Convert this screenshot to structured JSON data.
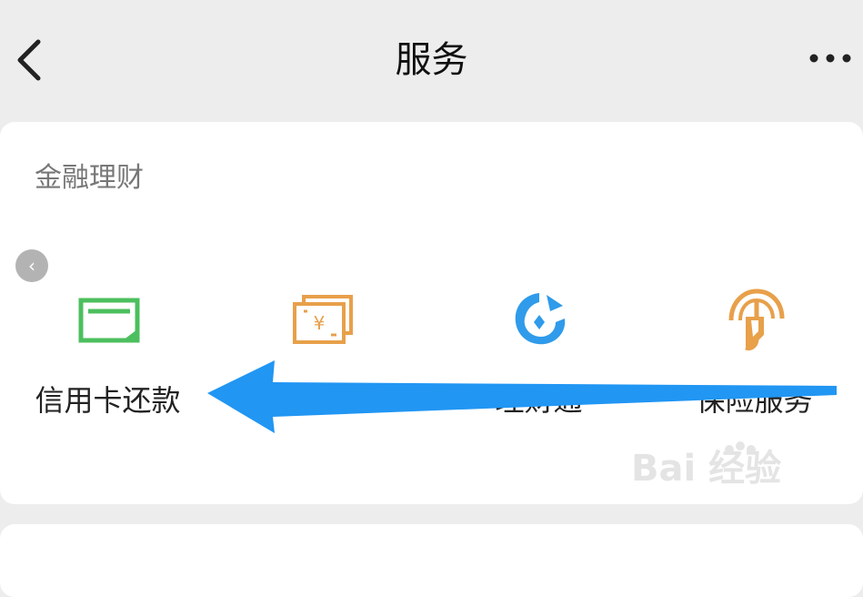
{
  "header": {
    "title": "服务",
    "back_icon": "chevron-left-icon",
    "more_icon": "more-horizontal-icon"
  },
  "finance": {
    "title": "金融理财",
    "services": [
      {
        "label": "信用卡还款",
        "icon": "credit-card-icon",
        "color": "#4cbf5e"
      },
      {
        "label": "",
        "icon": "wallet-yuan-icon",
        "color": "#e8a04a"
      },
      {
        "label": "理财通",
        "icon": "licaitong-icon",
        "color": "#2f9bea"
      },
      {
        "label": "保险服务",
        "icon": "insurance-umbrella-icon",
        "color": "#e8a04a"
      }
    ]
  },
  "annotation": {
    "arrow_color": "#2196f3"
  },
  "watermark": {
    "text": "Bai 经验",
    "icon": "baidu-paw-icon"
  }
}
